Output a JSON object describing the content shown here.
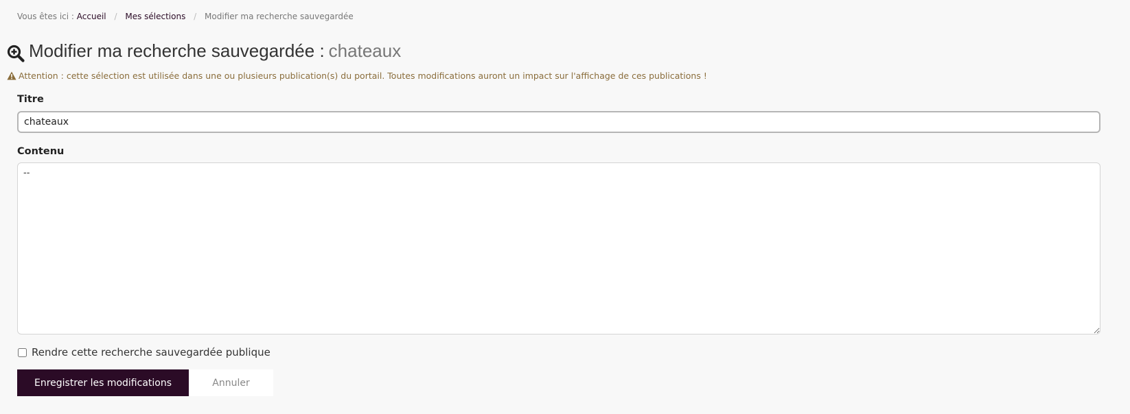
{
  "breadcrumb": {
    "prefix": "Vous êtes ici :",
    "items": [
      {
        "label": "Accueil"
      },
      {
        "label": "Mes sélections"
      }
    ],
    "current": "Modifier ma recherche sauvegardée",
    "separator": "/"
  },
  "page": {
    "title": "Modifier ma recherche sauvegardée :",
    "title_value": "chateaux",
    "title_icon": "search-plus-icon"
  },
  "warning": {
    "icon": "warning-triangle-icon",
    "text": "Attention : cette sélection est utilisée dans une ou plusieurs publication(s) du portail. Toutes modifications auront un impact sur l'affichage de ces publications !"
  },
  "form": {
    "titre_label": "Titre",
    "titre_value": "chateaux",
    "contenu_label": "Contenu",
    "contenu_value": "--",
    "public_label": "Rendre cette recherche sauvegardée publique",
    "public_checked": false,
    "save_label": "Enregistrer les modifications",
    "cancel_label": "Annuler"
  },
  "colors": {
    "primary": "#2b0b26",
    "warning": "#8a6d3b",
    "background": "#f8f8f8"
  }
}
